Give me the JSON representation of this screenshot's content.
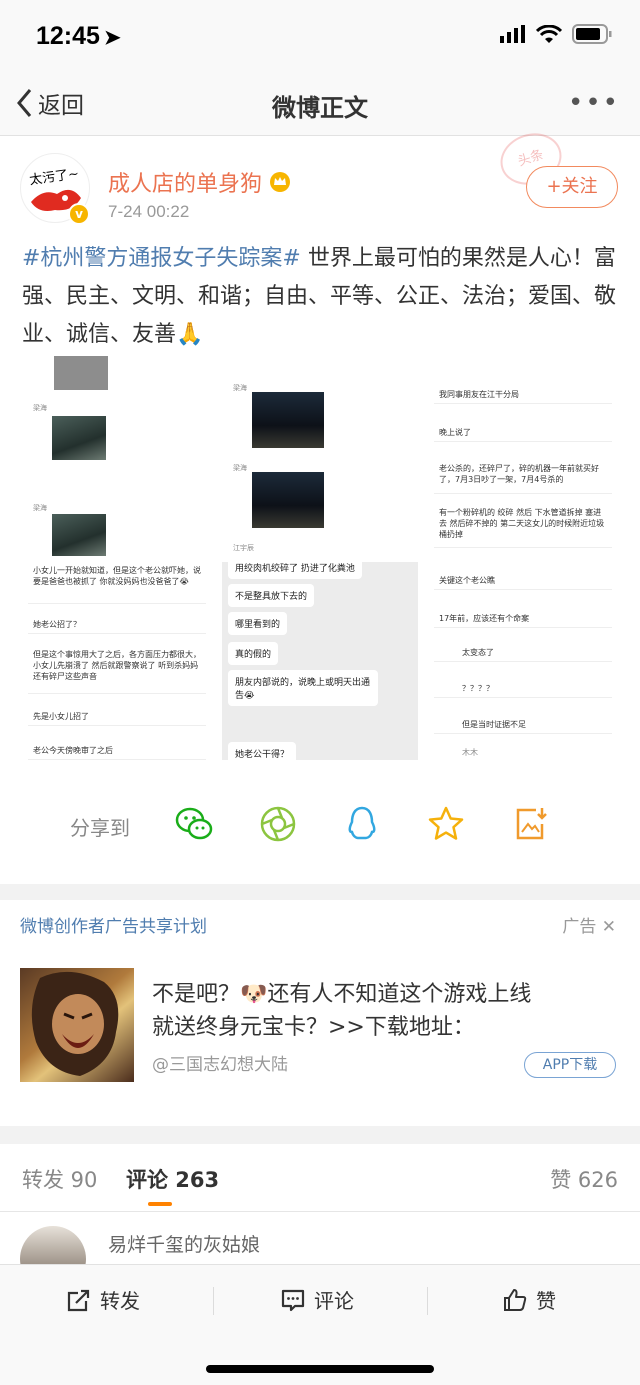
{
  "status": {
    "time": "12:45"
  },
  "nav": {
    "back": "返回",
    "title": "微博正文"
  },
  "post": {
    "avatar_text": "太污了~",
    "username": "成人店的单身狗",
    "time": "7-24 00:22",
    "stamp": "头条",
    "follow": "+关注",
    "hashtag": "#杭州警方通报女子失踪案#",
    "text": " 世界上最可怕的果然是人心！富强、民主、文明、和谐；自由、平等、公正、法治；爱国、敬业、诚信、友善🙏"
  },
  "image": {
    "col1": [
      {
        "name": "梁海",
        "text": ""
      },
      {
        "name": "梁海",
        "text": ""
      },
      {
        "name": "",
        "text": "小女儿一开始就知道，但是这个老公就吓她，说要是爸爸也被抓了 你就没妈妈也没爸爸了😭"
      },
      {
        "name": "Tequila",
        "text": "她老公招了？"
      },
      {
        "name": "Loki",
        "text": "但是这个事惊用大了之后，各方面压力都很大，小女儿先崩溃了 然后就跟警察说了 听到杀妈妈还有碎尸这些声音"
      },
      {
        "name": "Loki",
        "text": "先是小女儿招了"
      },
      {
        "name": "Loki",
        "text": "老公今天傍晚审了之后"
      }
    ],
    "col2_bubbles": [
      "用绞肉机绞碎了 扔进了化粪池",
      "不是整具放下去的",
      "哪里看到的",
      "真的假的",
      "朋友内部说的，说晚上或明天出通告😭",
      "她老公干得？"
    ],
    "col2_names": [
      "梁海",
      "梁海",
      "江宇辰"
    ],
    "col3": [
      {
        "name": "Loki",
        "text": "我同事朋友在江干分局"
      },
      {
        "name": "Loki",
        "text": "晚上说了"
      },
      {
        "name": "Loki",
        "text": "老公杀的，还碎尸了，碎的机器一年前就买好了，7月3日吵了一架，7月4号杀的"
      },
      {
        "name": "Loki",
        "text": "有一个粉碎机的 绞碎 然后 下水管道拆掉 塞进去 然后碎不掉的 第二天这女儿的时候附近垃圾桶扔掉"
      },
      {
        "name": "Loki",
        "text": "关键这个老公瞧"
      },
      {
        "name": "Loki",
        "text": "17年前，应该还有个命案"
      },
      {
        "name": "木木",
        "text": "太变态了"
      },
      {
        "name": "Tequila",
        "text": "？？？？"
      },
      {
        "name": "Loki",
        "text": "但是当时证据不足"
      },
      {
        "name": "木木",
        "text": ""
      }
    ]
  },
  "share": {
    "label": "分享到"
  },
  "ad": {
    "header": "微博创作者广告共享计划",
    "tag": "广告",
    "text_line1": "不是吧？🐶还有人不知道这个游戏上线",
    "text_line2": "就送终身元宝卡？>>下载地址：",
    "source": "@三国志幻想大陆",
    "button": "APP下载"
  },
  "tabs": {
    "repost": "转发 90",
    "comment": "评论 263",
    "like": "赞 626"
  },
  "comment": {
    "user": "易烊千玺的灰姑娘"
  },
  "bottom": {
    "repost": "转发",
    "comment": "评论",
    "like": "赞"
  },
  "colors": {
    "accent": "#eb7350",
    "link": "#507daf",
    "tab_underline": "#ff8200"
  }
}
